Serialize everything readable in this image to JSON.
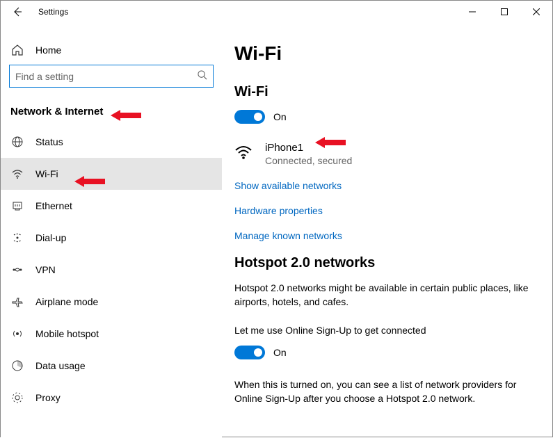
{
  "titlebar": {
    "title": "Settings"
  },
  "sidebar": {
    "home": "Home",
    "searchPlaceholder": "Find a setting",
    "category": "Network & Internet",
    "items": [
      {
        "label": "Status"
      },
      {
        "label": "Wi-Fi"
      },
      {
        "label": "Ethernet"
      },
      {
        "label": "Dial-up"
      },
      {
        "label": "VPN"
      },
      {
        "label": "Airplane mode"
      },
      {
        "label": "Mobile hotspot"
      },
      {
        "label": "Data usage"
      },
      {
        "label": "Proxy"
      }
    ]
  },
  "content": {
    "pageTitle": "Wi-Fi",
    "wifiSection": {
      "title": "Wi-Fi",
      "toggleLabel": "On"
    },
    "network": {
      "name": "iPhone1",
      "status": "Connected, secured"
    },
    "links": {
      "showNetworks": "Show available networks",
      "hardwareProps": "Hardware properties",
      "manageKnown": "Manage known networks"
    },
    "hotspot": {
      "title": "Hotspot 2.0 networks",
      "desc": "Hotspot 2.0 networks might be available in certain public places, like airports, hotels, and cafes.",
      "prompt": "Let me use Online Sign-Up to get connected",
      "toggleLabel": "On",
      "note": "When this is turned on, you can see a list of network providers for Online Sign-Up after you choose a Hotspot 2.0 network."
    }
  }
}
